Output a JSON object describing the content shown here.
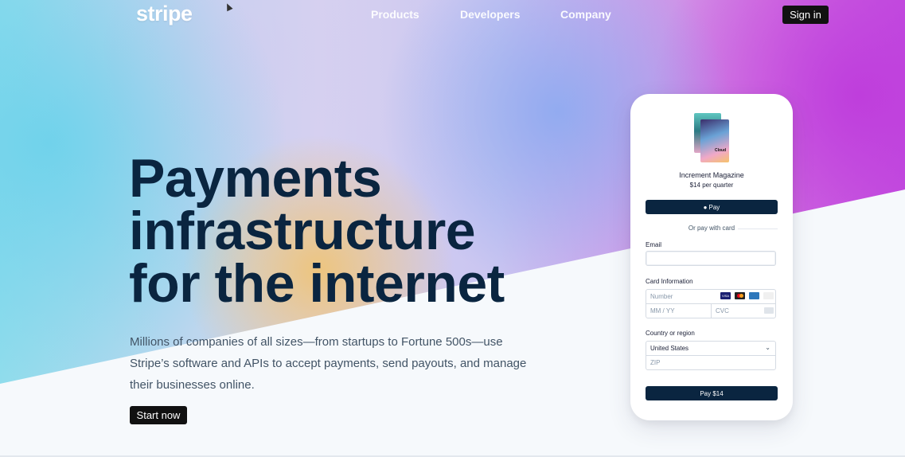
{
  "nav": {
    "logo": "stripe",
    "links": [
      "Products",
      "Developers",
      "Company"
    ],
    "sign_in": "Sign in"
  },
  "hero": {
    "headline": [
      "Payments",
      "infrastructure",
      "for the internet"
    ],
    "subtext": "Millions of companies of all sizes—from startups to Fortune 500s—use Stripe’s software and APIs to accept payments, send payouts, and manage their businesses online.",
    "cta": "Start now"
  },
  "checkout": {
    "product_name": "Increment Magazine",
    "product_price": "$14 per quarter",
    "magazine_label": "Cloud",
    "apple_pay_label": "Pay",
    "apple_icon": "apple-icon",
    "or_pay": "Or pay with card",
    "email_label": "Email",
    "email_value": "",
    "card_label": "Card Information",
    "card_number_placeholder": "Number",
    "card_exp_placeholder": "MM / YY",
    "card_cvc_placeholder": "CVC",
    "card_brands": [
      "VISA",
      "MC",
      "AMEX",
      "DISC"
    ],
    "country_label": "Country or region",
    "country_value": "United States",
    "zip_placeholder": "ZIP",
    "pay_button": "Pay $14"
  },
  "colors": {
    "brand_dark": "#0a2540",
    "button_black": "#111111",
    "visa": "#1a1f71",
    "mastercard": "#eb001b",
    "amex": "#2e77bb",
    "discover": "#f0f0f0"
  }
}
